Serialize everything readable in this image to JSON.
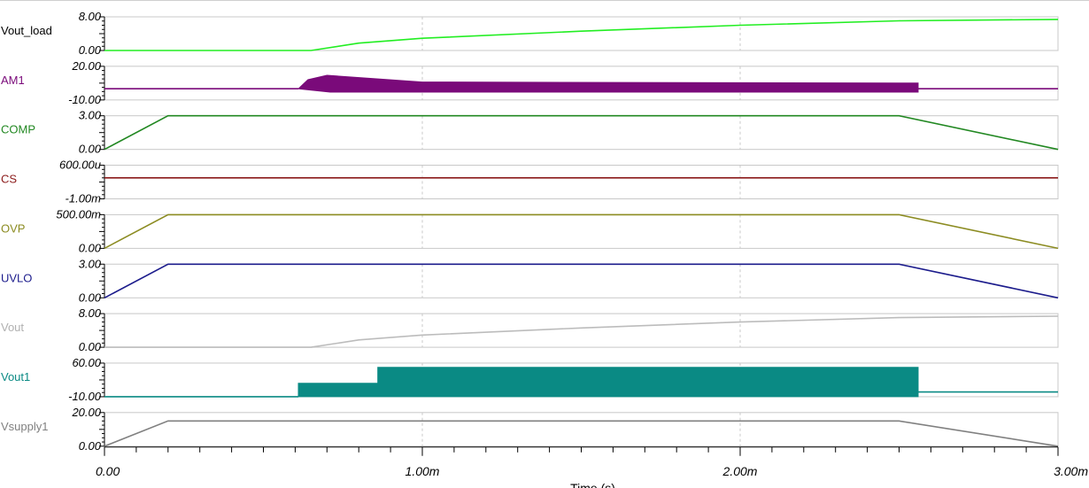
{
  "chart_data": {
    "type": "line",
    "x_axis": {
      "label": "Time (s)",
      "range": [
        0,
        0.003
      ],
      "ticks": [
        {
          "value": 0,
          "label": "0.00"
        },
        {
          "value": 0.001,
          "label": "1.00m"
        },
        {
          "value": 0.002,
          "label": "2.00m"
        },
        {
          "value": 0.003,
          "label": "3.00m"
        }
      ],
      "grid": true
    },
    "panels": [
      {
        "name": "Vout_load",
        "color": "#22ee22",
        "ylim": [
          0,
          8
        ],
        "ytick_top": "8.00",
        "ytick_bottom": "0.00",
        "points": [
          [
            0,
            0
          ],
          [
            0.00065,
            0
          ],
          [
            0.0008,
            1.75
          ],
          [
            0.001,
            2.9
          ],
          [
            0.0015,
            4.6
          ],
          [
            0.002,
            6.0
          ],
          [
            0.0025,
            7.05
          ],
          [
            0.003,
            7.4
          ]
        ]
      },
      {
        "name": "AM1",
        "color": "#7a0a7a",
        "ylim": [
          -10,
          20
        ],
        "ytick_top": "20.00",
        "ytick_bottom": "-10.00",
        "baseline": 0,
        "burst": {
          "start": 0.00061,
          "end": 0.00256,
          "upper_start": 8,
          "upper_peak": 12,
          "upper_end": 5,
          "lower": -3,
          "peak_at": 0.0007
        }
      },
      {
        "name": "COMP",
        "color": "#228822",
        "ylim": [
          0,
          3
        ],
        "ytick_top": "3.00",
        "ytick_bottom": "0.00",
        "points": [
          [
            0,
            0
          ],
          [
            0.0002,
            3
          ],
          [
            0.0025,
            3
          ],
          [
            0.003,
            0
          ]
        ]
      },
      {
        "name": "CS",
        "color": "#8b1a1a",
        "ylim": [
          -0.001,
          0.0006
        ],
        "ytick_top": "600.00u",
        "ytick_bottom": "-1.00m",
        "points": [
          [
            0,
            0
          ],
          [
            0.003,
            0
          ]
        ]
      },
      {
        "name": "OVP",
        "color": "#8c8c22",
        "ylim": [
          0,
          0.5
        ],
        "ytick_top": "500.00m",
        "ytick_bottom": "0.00",
        "points": [
          [
            0,
            0
          ],
          [
            0.0002,
            0.5
          ],
          [
            0.0025,
            0.5
          ],
          [
            0.003,
            0
          ]
        ]
      },
      {
        "name": "UVLO",
        "color": "#1c1c8c",
        "ylim": [
          0,
          3
        ],
        "ytick_top": "3.00",
        "ytick_bottom": "0.00",
        "points": [
          [
            0,
            0
          ],
          [
            0.0002,
            3
          ],
          [
            0.0025,
            3
          ],
          [
            0.003,
            0
          ]
        ]
      },
      {
        "name": "Vout",
        "color": "#bcbcbc",
        "ylim": [
          0,
          8
        ],
        "ytick_top": "8.00",
        "ytick_bottom": "0.00",
        "points": [
          [
            0,
            0
          ],
          [
            0.00065,
            0
          ],
          [
            0.0008,
            1.75
          ],
          [
            0.001,
            2.9
          ],
          [
            0.0015,
            4.6
          ],
          [
            0.002,
            6.0
          ],
          [
            0.0025,
            7.05
          ],
          [
            0.003,
            7.4
          ]
        ]
      },
      {
        "name": "Vout1",
        "color": "#0a8a84",
        "ylim": [
          -10,
          60
        ],
        "ytick_top": "60.00",
        "ytick_bottom": "-10.00",
        "baseline": -10,
        "burst": {
          "start": 0.00061,
          "end": 0.00256,
          "upper_start": 18,
          "upper_peak": 51,
          "upper_end": 51,
          "lower": -10,
          "step_at": 0.00086
        },
        "tail_level": 0
      },
      {
        "name": "Vsupply1",
        "color": "#808080",
        "ylim": [
          0,
          20
        ],
        "ytick_top": "20.00",
        "ytick_bottom": "0.00",
        "points": [
          [
            0,
            0
          ],
          [
            0.0002,
            15
          ],
          [
            0.0025,
            15
          ],
          [
            0.003,
            0
          ]
        ]
      }
    ]
  }
}
